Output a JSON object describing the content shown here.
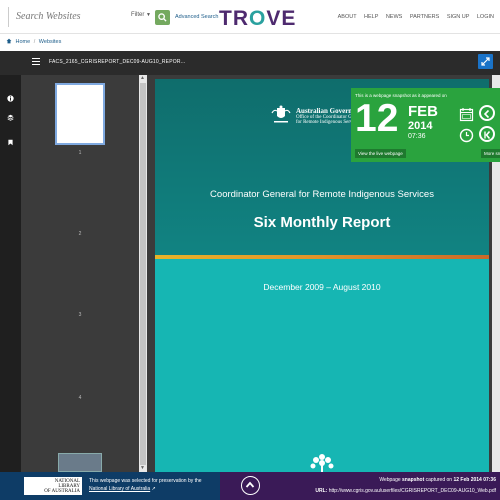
{
  "header": {
    "search_placeholder": "Search Websites",
    "filter_label": "Filter",
    "advanced_search": "Advanced Search",
    "logo": "TROVE",
    "nav": [
      "ABOUT",
      "HELP",
      "NEWS",
      "PARTNERS",
      "SIGN UP",
      "LOGIN"
    ]
  },
  "breadcrumb": {
    "home": "Home",
    "separator": "/",
    "current": "Websites"
  },
  "viewer": {
    "doc_title": "FACS_2165_CGRISREPORT_DEC09-AUG10_REPOR...",
    "thumbnails": [
      {
        "page": "1"
      },
      {
        "page": "2"
      },
      {
        "page": "3"
      },
      {
        "page": "4"
      }
    ]
  },
  "document": {
    "gov_line1": "Australian Government",
    "gov_line2": "Office of the Coordinator General",
    "gov_line3": "for Remote Indigenous Services",
    "heading": "Coordinator General for Remote Indigenous Services",
    "title": "Six Monthly Report",
    "dates": "December 2009 – August 2010"
  },
  "snapshot": {
    "note": "This is a webpage snapshot as it appeared on",
    "day": "12",
    "month": "FEB",
    "year": "2014",
    "time": "07:36",
    "view_live": "View the live webpage",
    "more": "More sn"
  },
  "footer": {
    "nla_line1": "NATIONAL",
    "nla_line2": "LIBRARY",
    "nla_line3": "OF AUSTRALIA",
    "selected_text": "This webpage was selected for preservation by the",
    "selected_link": "National Library of Australia",
    "captured_prefix": "Webpage",
    "captured_bold": "snapshot",
    "captured_mid": "captured on",
    "captured_date": "12 Feb 2014 07:36",
    "url_label": "URL:",
    "url": "http://www.cgris.gov.au/userfiles/CGRISREPORT_DEC09-AUG10_Web.pdf"
  },
  "colors": {
    "accent_green": "#2aa33e",
    "footer_blue": "#0e3c66",
    "footer_purple": "#3a1a57",
    "doc_teal": "#127775",
    "logo_purple": "#4e2a6f",
    "logo_teal": "#2aa19f"
  }
}
